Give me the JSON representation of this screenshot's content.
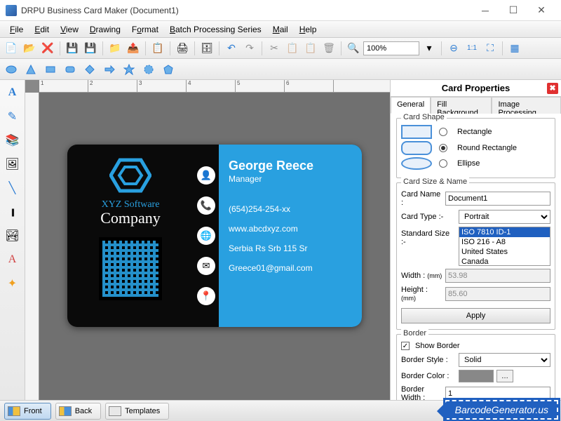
{
  "window": {
    "title": "DRPU Business Card Maker (Document1)"
  },
  "menu": {
    "file": "File",
    "edit": "Edit",
    "view": "View",
    "drawing": "Drawing",
    "format": "Format",
    "batch": "Batch Processing Series",
    "mail": "Mail",
    "help": "Help"
  },
  "toolbar": {
    "zoom": "100%"
  },
  "ruler": {
    "marks": [
      "1",
      "2",
      "3",
      "4",
      "5",
      "6"
    ]
  },
  "card": {
    "company_top": "XYZ Software",
    "company_bottom": "Company",
    "name": "George Reece",
    "role": "Manager",
    "phone": "(654)254-254-xx",
    "website": "www.abcdxyz.com",
    "address": "Serbia Rs Srb 115 Sr",
    "email": "Greece01@gmail.com"
  },
  "props": {
    "title": "Card Properties",
    "tabs": {
      "general": "General",
      "fill": "Fill Background",
      "image": "Image Processing"
    },
    "shape": {
      "legend": "Card Shape",
      "rectangle": "Rectangle",
      "round_rect": "Round Rectangle",
      "ellipse": "Ellipse",
      "selected": "round_rect"
    },
    "size": {
      "legend": "Card Size & Name",
      "name_label": "Card Name :",
      "name_value": "Document1",
      "type_label": "Card Type :-",
      "type_value": "Portrait",
      "std_label": "Standard Size :-",
      "std_options": [
        "ISO 7810 ID-1",
        "ISO 216 - A8",
        "United States",
        "Canada"
      ],
      "std_selected": "ISO 7810 ID-1",
      "width_label": "Width :",
      "width_unit": "(mm)",
      "width_value": "53.98",
      "height_label": "Height :",
      "height_unit": "(mm)",
      "height_value": "85.60",
      "apply": "Apply"
    },
    "border": {
      "legend": "Border",
      "show": "Show Border",
      "style_label": "Border Style :",
      "style_value": "Solid",
      "color_label": "Border Color :",
      "width_label": "Border Width :",
      "width_value": "1"
    }
  },
  "bottom": {
    "front": "Front",
    "back": "Back",
    "templates": "Templates"
  },
  "brand": "BarcodeGenerator.us"
}
